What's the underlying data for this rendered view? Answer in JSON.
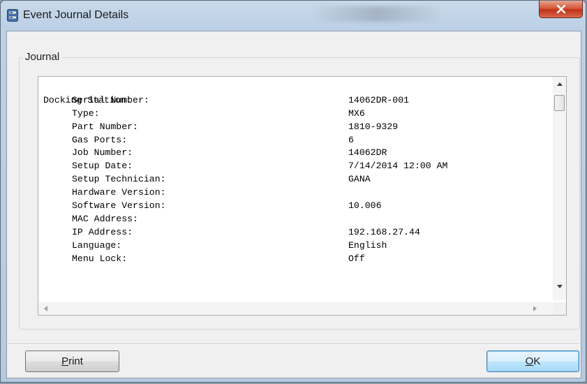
{
  "window": {
    "title": "Event Journal Details",
    "close_label": "X",
    "title_icon": "server-icon"
  },
  "journal": {
    "group_label": "Journal",
    "section_header": "Docking Station:",
    "rows": [
      {
        "label": "Serial Number:",
        "value": "14062DR-001"
      },
      {
        "label": "Type:",
        "value": "MX6"
      },
      {
        "label": "Part Number:",
        "value": "1810-9329"
      },
      {
        "label": "Gas Ports:",
        "value": "6"
      },
      {
        "label": "Job Number:",
        "value": "14062DR"
      },
      {
        "label": "Setup Date:",
        "value": "7/14/2014 12:00 AM"
      },
      {
        "label": "Setup Technician:",
        "value": "GANA"
      },
      {
        "label": "Hardware Version:",
        "value": ""
      },
      {
        "label": "Software Version:",
        "value": "10.006"
      },
      {
        "label": "MAC Address:",
        "value": ""
      },
      {
        "label": "IP Address:",
        "value": "192.168.27.44"
      },
      {
        "label": "Language:",
        "value": "English"
      },
      {
        "label": "Menu Lock:",
        "value": "Off"
      }
    ]
  },
  "buttons": {
    "print": {
      "mnemonic": "P",
      "rest": "rint"
    },
    "ok": {
      "mnemonic": "O",
      "rest": "K"
    }
  },
  "colors": {
    "close_button": "#c7412a",
    "ok_border": "#3c7fb1",
    "frame": "#bcd0e6"
  }
}
